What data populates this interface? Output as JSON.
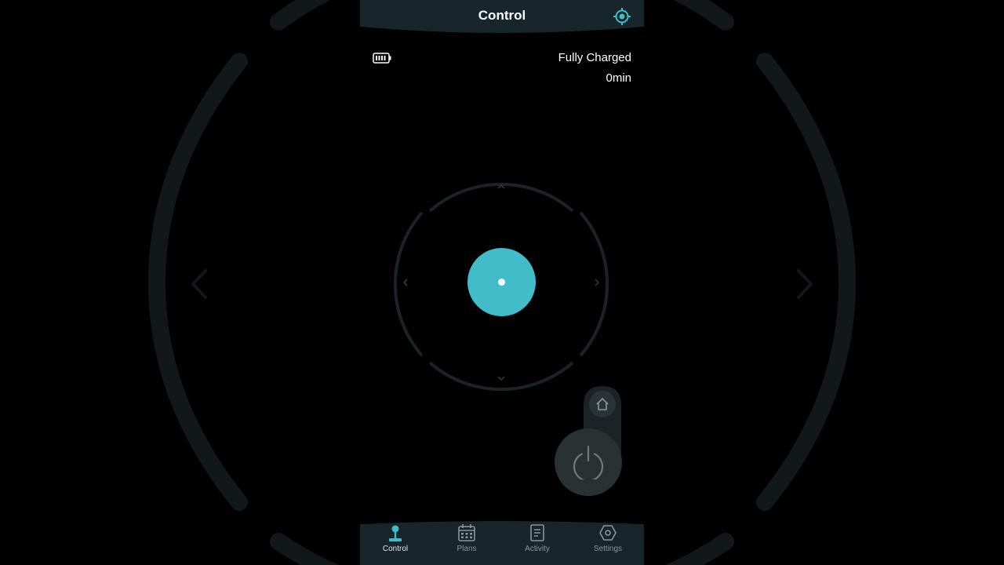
{
  "header": {
    "title": "Control",
    "locate_icon": "locate-target-icon"
  },
  "status": {
    "battery_icon": "battery-full-icon",
    "battery_text": "Fully Charged",
    "time_text": "0min"
  },
  "joystick": {
    "directions": [
      "up",
      "down",
      "left",
      "right"
    ],
    "knob_color": "#43bcc9"
  },
  "actions": {
    "home_icon": "home-icon",
    "power_icon": "power-icon"
  },
  "tabs": [
    {
      "label": "Control",
      "icon": "joystick-icon",
      "active": true
    },
    {
      "label": "Plans",
      "icon": "calendar-icon",
      "active": false
    },
    {
      "label": "Activity",
      "icon": "document-icon",
      "active": false
    },
    {
      "label": "Settings",
      "icon": "hexagon-settings-icon",
      "active": false
    }
  ],
  "colors": {
    "accent": "#43bcc9",
    "header_bg": "#16262b",
    "background": "#000000"
  }
}
